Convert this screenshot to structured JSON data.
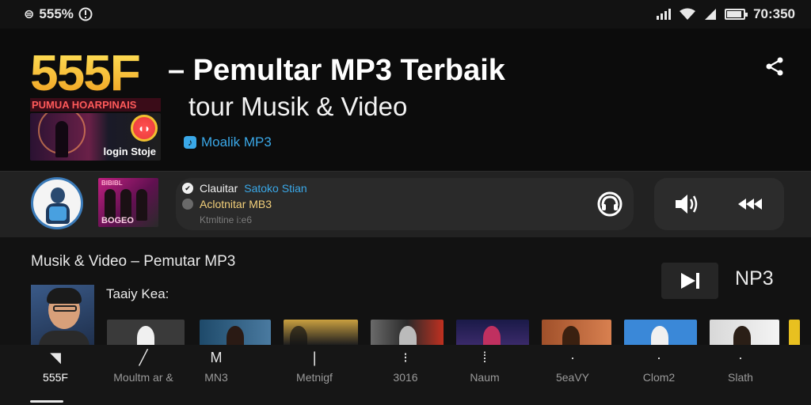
{
  "status_bar": {
    "left_glyph": "⊜",
    "left_text": "555%",
    "right_text": "70:350",
    "icons": [
      "sync-icon",
      "alert-icon",
      "signal-icon",
      "wifi-icon",
      "battery-icon"
    ]
  },
  "header": {
    "logo_text": "555F",
    "logo_subtext": "PUMUA HOARPINAIS",
    "logo_caption": "login Stoje",
    "title": "– Pemultar MP3 Terbaik",
    "subtitle": "tour Musik & Video",
    "developer": "Moalik MP3",
    "share_icon": "share-icon"
  },
  "player": {
    "album_caption": "BOGEO",
    "album_top": "BIBIBL",
    "line1_prefix": "Clauitar",
    "line1_accent": "Satoko Stian",
    "line2": "Aclotnitar MB3",
    "line3": "Ktmltine i:e6",
    "colors": {
      "accent": "#3aa8e8",
      "line2": "#f3d07a"
    }
  },
  "content": {
    "section_title": "Musik & Video – Pemutar MP3",
    "feature_label": "Taaiy Kea:",
    "next_label": "NP3"
  },
  "thumbnail_colors": [
    "#3a3a3a",
    "#1e4a6a",
    "#caa040",
    "#6a6a6a",
    "#1a1a48",
    "#a0502a",
    "#3a88d8",
    "#d8d8d8",
    "#e8c020"
  ],
  "bottom_nav": {
    "tabs": [
      {
        "label": "555F",
        "icon": "home-icon",
        "glyph": "◥"
      },
      {
        "label": "Moultm ar &",
        "icon": "pen-icon",
        "glyph": "╱"
      },
      {
        "label": "MN3",
        "icon": "music-icon",
        "glyph": "M"
      },
      {
        "label": "Metnigf",
        "icon": "metric-icon",
        "glyph": "❘"
      },
      {
        "label": "3016",
        "icon": "grid-icon",
        "glyph": "⁝"
      },
      {
        "label": "Naum",
        "icon": "dots-icon",
        "glyph": "⁞"
      },
      {
        "label": "5eaVY",
        "icon": "star-icon",
        "glyph": "·"
      },
      {
        "label": "Clom2",
        "icon": "cloud-icon",
        "glyph": "·"
      },
      {
        "label": "Slath",
        "icon": "slash-icon",
        "glyph": "·"
      }
    ]
  }
}
